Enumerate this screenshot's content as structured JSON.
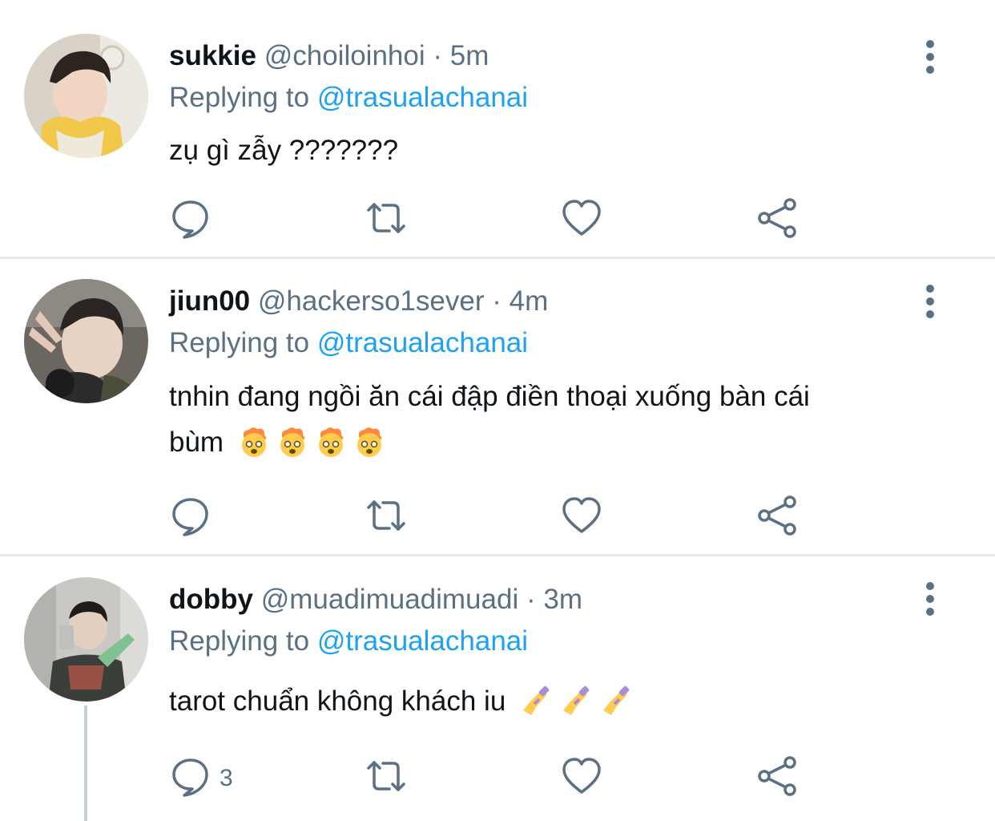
{
  "tweets": [
    {
      "name": "sukkie",
      "handle": "@choiloinhoi",
      "separator": "·",
      "time": "5m",
      "replying_prefix": "Replying to",
      "replying_to": "@trasualachanai",
      "text": "zụ gì zẫy ???????",
      "text_line2": "",
      "emoji": [],
      "reply_count": "",
      "avatar_icon": "avatar-photo"
    },
    {
      "name": "jiun00",
      "handle": "@hackerso1sever",
      "separator": "·",
      "time": "4m",
      "replying_prefix": "Replying to",
      "replying_to": "@trasualachanai",
      "text": "tnhin đang ngồi ăn cái đập điền thoại xuống bàn cái",
      "text_line2": "bùm",
      "emoji": [
        "exploding-head-emoji",
        "exploding-head-emoji",
        "exploding-head-emoji",
        "exploding-head-emoji"
      ],
      "reply_count": "",
      "avatar_icon": "avatar-photo"
    },
    {
      "name": "dobby",
      "handle": "@muadimuadimuadi",
      "separator": "·",
      "time": "3m",
      "replying_prefix": "Replying to",
      "replying_to": "@trasualachanai",
      "text": "tarot chuẩn không khách iu",
      "text_line2": "",
      "emoji": [
        "nail-polish-emoji",
        "nail-polish-emoji",
        "nail-polish-emoji"
      ],
      "reply_count": "3",
      "avatar_icon": "avatar-photo"
    }
  ],
  "actions": [
    "reply-icon",
    "retweet-icon",
    "like-icon",
    "share-icon"
  ],
  "colors": {
    "link": "#1da1f2",
    "secondary_text": "#5b7083",
    "icon": "#5b7083",
    "divider": "#e6e8ea",
    "thread_line": "#c4cfd6"
  }
}
